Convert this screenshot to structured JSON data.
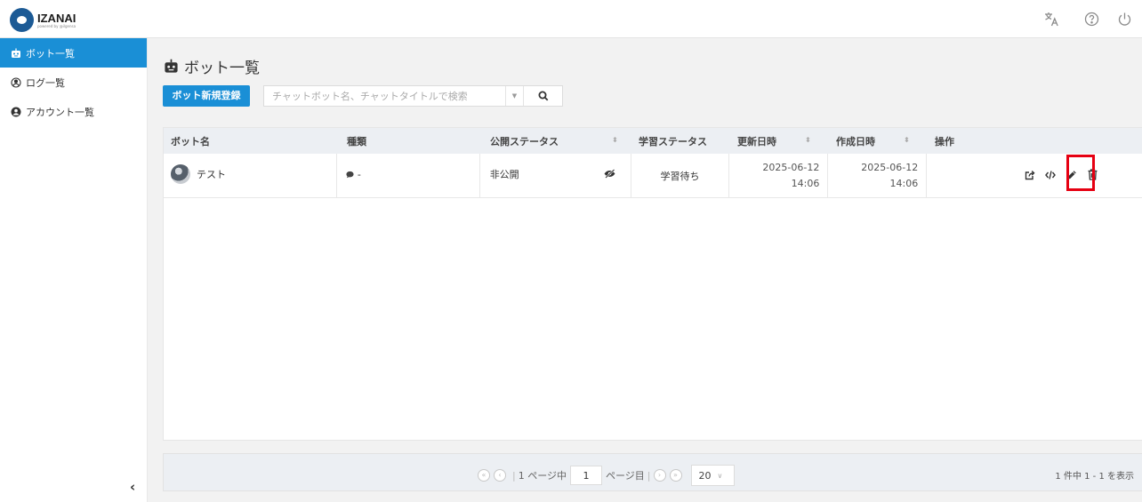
{
  "header": {
    "logo_name": "IZANAI",
    "logo_sub": "powered by @ilgensa",
    "icons": [
      "translate-icon",
      "help-icon",
      "power-icon"
    ]
  },
  "sidebar": {
    "items": [
      {
        "label": "ボット一覧",
        "icon": "robot-icon",
        "active": true
      },
      {
        "label": "ログ一覧",
        "icon": "log-icon",
        "active": false
      },
      {
        "label": "アカウント一覧",
        "icon": "account-icon",
        "active": false
      }
    ],
    "collapse_label": "‹"
  },
  "page": {
    "title": "ボット一覧",
    "new_button": "ボット新規登録",
    "search_placeholder": "チャットボット名、チャットタイトルで検索"
  },
  "table": {
    "headers": [
      "ボット名",
      "種類",
      "公開ステータス",
      "学習ステータス",
      "更新日時",
      "作成日時",
      "操作"
    ],
    "rows": [
      {
        "name": "テスト",
        "type": "-",
        "public_status": "非公開",
        "learn_status": "学習待ち",
        "updated_date": "2025-06-12",
        "updated_time": "14:06",
        "created_date": "2025-06-12",
        "created_time": "14:06"
      }
    ]
  },
  "pager": {
    "page_prefix": "1 ページ中",
    "current_page": "1",
    "page_suffix": "ページ目",
    "page_size": "20",
    "info": "1 件中 1 - 1 を表示"
  },
  "colors": {
    "accent": "#1a8fd6",
    "highlight": "#e60012"
  }
}
